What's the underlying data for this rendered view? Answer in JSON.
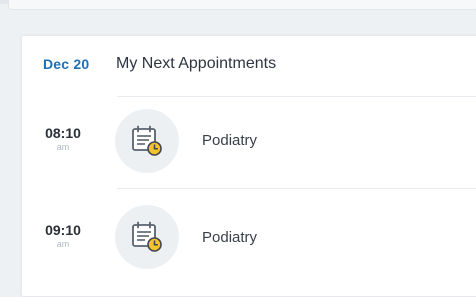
{
  "header": {
    "date": "Dec 20",
    "title": "My Next Appointments"
  },
  "appointments": [
    {
      "time": "08:10",
      "ampm": "am",
      "name": "Podiatry",
      "icon": "calendar-clock-icon"
    },
    {
      "time": "09:10",
      "ampm": "am",
      "name": "Podiatry",
      "icon": "calendar-clock-icon"
    }
  ],
  "colors": {
    "accent": "#1f6fb5",
    "icon_stroke": "#5a6270",
    "clock_fill": "#f2c42c"
  }
}
